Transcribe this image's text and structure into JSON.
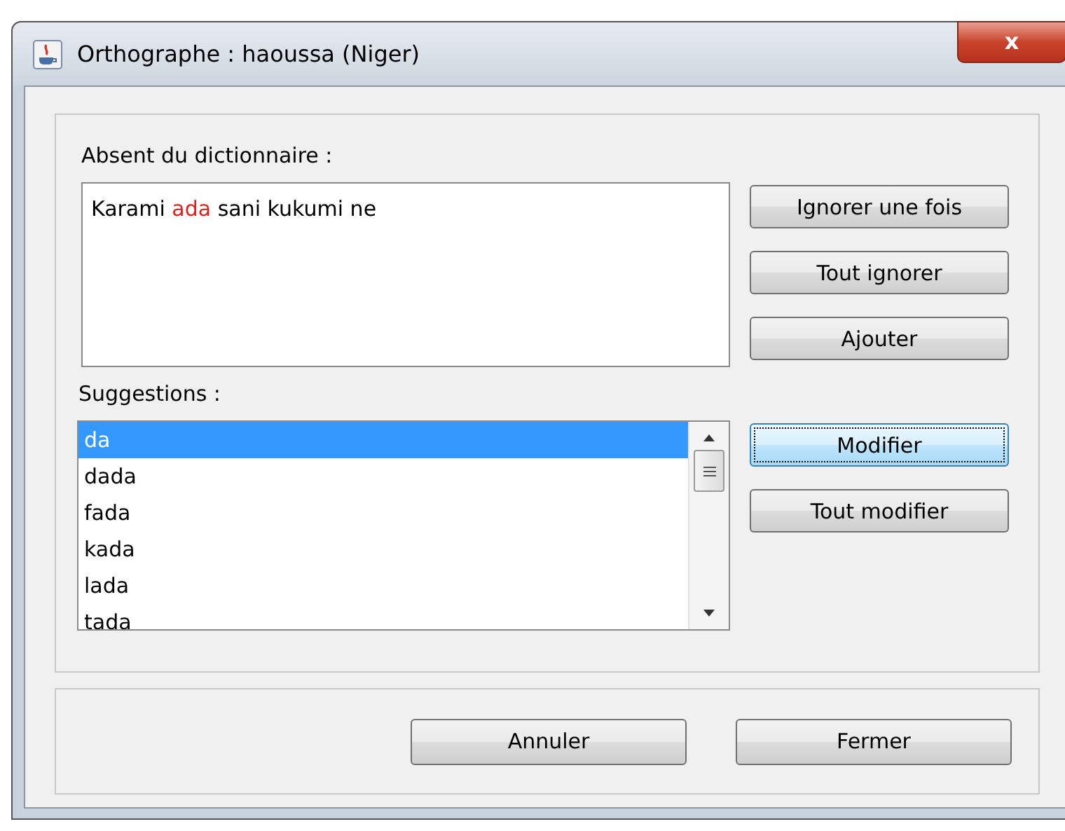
{
  "window": {
    "title": "Orthographe : haoussa (Niger)",
    "close_label": "x"
  },
  "not_in_dictionary": {
    "label": "Absent du dictionnaire :",
    "context": [
      {
        "text": "Karami ",
        "error": false
      },
      {
        "text": "ada",
        "error": true
      },
      {
        "text": " sani kukumi ne",
        "error": false
      }
    ]
  },
  "side_buttons": [
    {
      "label": "Ignorer une fois",
      "focused": false
    },
    {
      "label": "Tout ignorer",
      "focused": false
    },
    {
      "label": "Ajouter",
      "focused": false
    }
  ],
  "suggestions": {
    "label": "Suggestions :",
    "items": [
      {
        "text": "da",
        "selected": true
      },
      {
        "text": "dada",
        "selected": false
      },
      {
        "text": "fada",
        "selected": false
      },
      {
        "text": "kada",
        "selected": false
      },
      {
        "text": "lada",
        "selected": false
      },
      {
        "text": "tada",
        "selected": false
      }
    ]
  },
  "suggestion_buttons": [
    {
      "label": "Modifier",
      "focused": true
    },
    {
      "label": "Tout modifier",
      "focused": false
    }
  ],
  "footer_buttons": [
    {
      "label": "Annuler"
    },
    {
      "label": "Fermer"
    }
  ]
}
